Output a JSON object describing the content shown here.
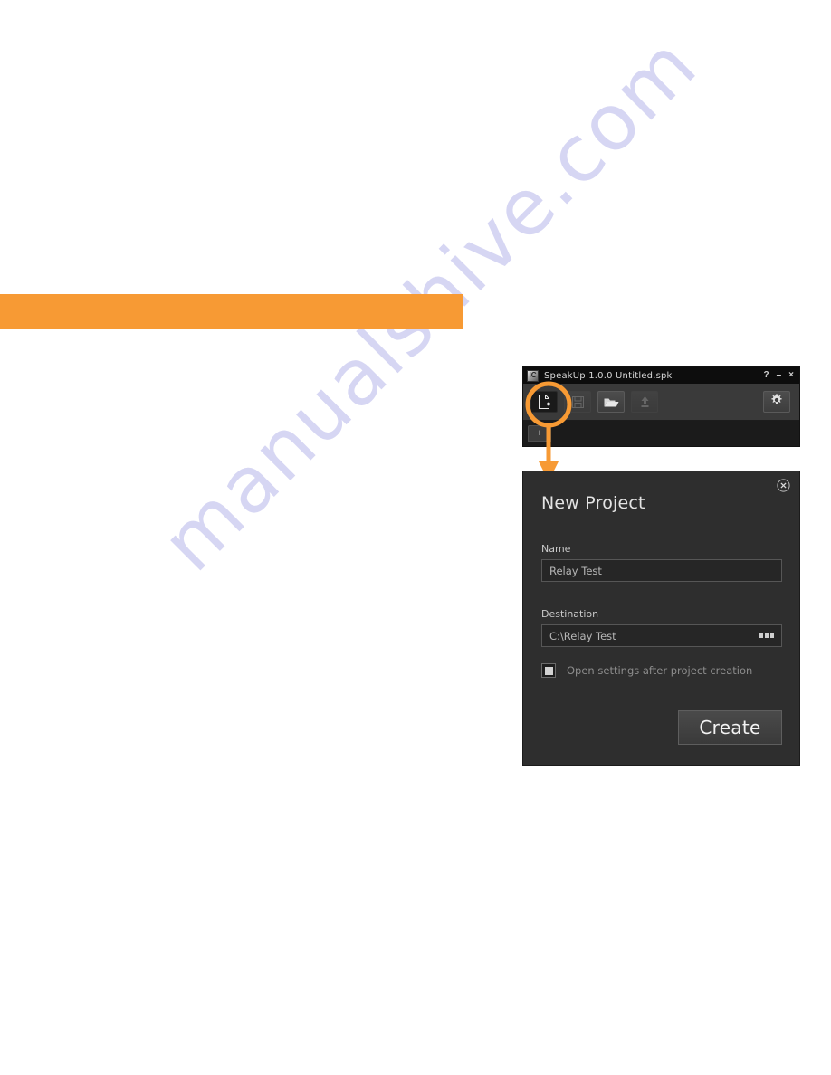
{
  "page": {
    "watermark_text": "manualshive.com",
    "watermark_color": "#c9c9ef",
    "accent_color": "#f79a34",
    "background_color": "#ffffff"
  },
  "app_window": {
    "titlebar": {
      "app_icon": "speakup-app-icon",
      "title": "SpeakUp 1.0.0  Untitled.spk",
      "controls": [
        {
          "name": "help-button",
          "glyph": "?"
        },
        {
          "name": "minimize-button",
          "glyph": "–"
        },
        {
          "name": "close-button",
          "glyph": "×"
        }
      ]
    },
    "toolbar": {
      "buttons": [
        {
          "name": "new-project-button",
          "icon": "new-document-icon",
          "state": "active"
        },
        {
          "name": "save-project-button",
          "icon": "floppy-disk-icon",
          "state": "disabled"
        },
        {
          "name": "open-project-button",
          "icon": "open-folder-icon",
          "state": "enabled"
        },
        {
          "name": "upload-project-button",
          "icon": "upload-arrow-icon",
          "state": "disabled"
        }
      ],
      "settings_button": {
        "name": "settings-button",
        "icon": "gear-icon"
      }
    },
    "tabbar": {
      "add_tab_label": "+"
    }
  },
  "callout": {
    "highlight_target": "new-project-button",
    "color": "#f79a34",
    "arrow_direction": "down"
  },
  "dialog": {
    "title": "New Project",
    "close_label": "✕",
    "name_field": {
      "label": "Name",
      "value": "Relay Test",
      "placeholder": "Relay Test"
    },
    "destination_field": {
      "label": "Destination",
      "value": "C:\\Relay Test",
      "placeholder": "C:\\Relay Test",
      "browse_label": "•••"
    },
    "checkbox": {
      "label": "Open settings after project creation",
      "checked": false
    },
    "create_button_label": "Create"
  }
}
